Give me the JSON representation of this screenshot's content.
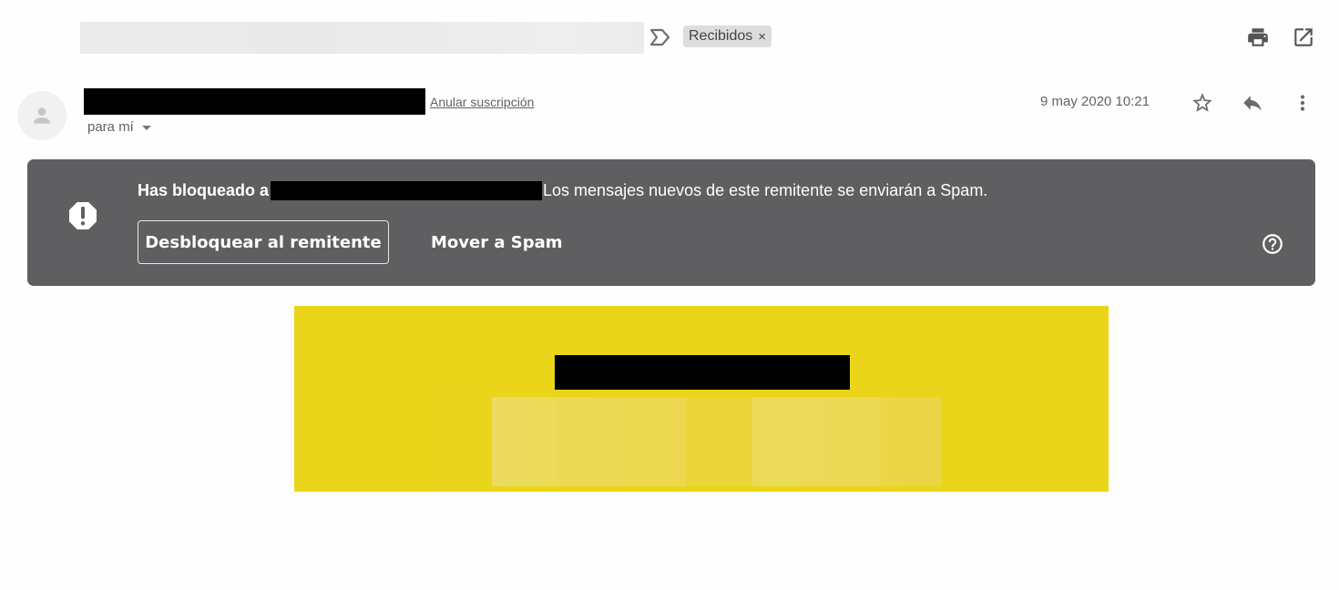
{
  "subject": {
    "redacted": true,
    "label_chip": {
      "text": "Recibidos",
      "remove_glyph": "×"
    },
    "icons": {
      "importance": "importance-marker-icon",
      "print": "print-icon",
      "open_new_window": "open-in-new-window-icon"
    }
  },
  "message_header": {
    "sender_redacted": true,
    "unsubscribe_label": "Anular suscripción",
    "recipient_label": "para mí",
    "date": "9 may 2020 10:21",
    "icons": {
      "avatar": "person-icon",
      "star": "star-icon",
      "reply": "reply-icon",
      "more": "more-vert-icon"
    }
  },
  "blocked_banner": {
    "bold_prefix": "Has bloqueado a",
    "message_suffix": "Los mensajes nuevos de este remitente se enviarán a Spam.",
    "unblock_button": "Desbloquear al remitente",
    "move_to_spam_button": "Mover a Spam",
    "icons": {
      "warning": "report-octagon-icon",
      "help": "help-circle-icon"
    },
    "background_color": "#5f5e60"
  },
  "email_body": {
    "image_background_color": "#ebd51a",
    "content_redacted": true
  }
}
